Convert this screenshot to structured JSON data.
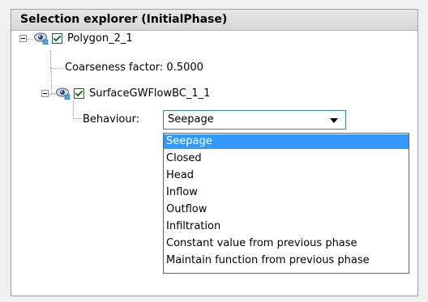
{
  "panel": {
    "title": "Selection explorer (InitialPhase)"
  },
  "tree": {
    "root": {
      "label": "Polygon_2_1",
      "checked": true,
      "expanded": true
    },
    "coarseness": "Coarseness factor: 0.5000",
    "child": {
      "label": "SurfaceGWFlowBC_1_1",
      "checked": true,
      "expanded": true
    },
    "behaviour_label": "Behaviour:"
  },
  "behaviour_select": {
    "value": "Seepage",
    "options": [
      "Seepage",
      "Closed",
      "Head",
      "Inflow",
      "Outflow",
      "Infiltration",
      "Constant value from previous phase",
      "Maintain function from previous phase"
    ],
    "selected_index": 0
  },
  "colors": {
    "highlight": "#3399ff",
    "check": "#1a7a1a",
    "select_border": "#3c7fb1"
  },
  "icons": [
    "expand-collapse-icon",
    "visibility-eye-icon",
    "checkbox-checked-icon",
    "dropdown-arrow-icon"
  ]
}
